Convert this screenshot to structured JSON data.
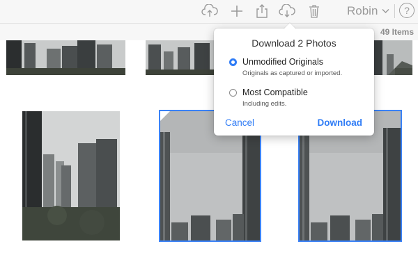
{
  "toolbar": {
    "icons": [
      "upload-cloud-icon",
      "plus-icon",
      "share-icon",
      "download-cloud-icon",
      "trash-icon",
      "help-icon"
    ],
    "user_name": "Robin",
    "help_label": "?",
    "icon_color": "#9a9a9a"
  },
  "library": {
    "item_count": "49 Items"
  },
  "download_popover": {
    "title": "Download 2 Photos",
    "options": [
      {
        "label": "Unmodified Originals",
        "description": "Originals as captured or imported.",
        "selected": true
      },
      {
        "label": "Most Compatible",
        "description": "Including edits.",
        "selected": false
      }
    ],
    "cancel_label": "Cancel",
    "download_label": "Download",
    "accent_color": "#2f7cf6"
  }
}
